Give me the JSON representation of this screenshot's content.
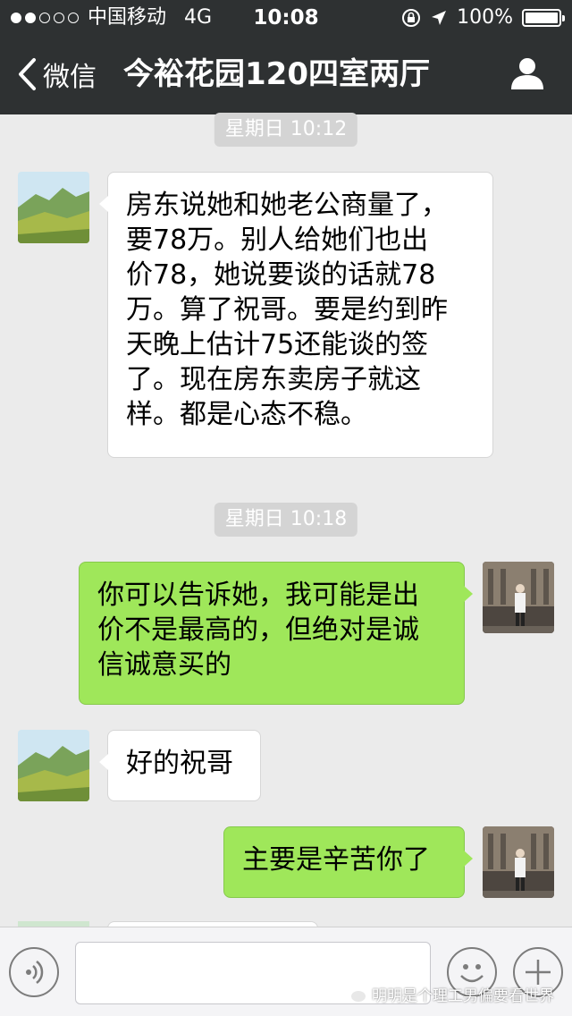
{
  "status_bar": {
    "carrier": "中国移动",
    "network": "4G",
    "time": "10:08",
    "battery": "100%",
    "signal_dots_filled": 2,
    "signal_dots_total": 5
  },
  "nav": {
    "back_label": "微信",
    "title": "今裕花园120四室两厅"
  },
  "messages": [
    {
      "type": "timestamp",
      "text": "星期日 10:12"
    },
    {
      "type": "incoming",
      "lines": [
        "房东说她和她老公商量了，",
        "要78万。别人给她们也出",
        "价78，她说要谈的话就78",
        "万。算了祝哥。要是约到昨",
        "天晚上估计75还能谈的签",
        "了。现在房东卖房子就这",
        "样。都是心态不稳。"
      ]
    },
    {
      "type": "timestamp",
      "text": "星期日 10:18"
    },
    {
      "type": "outgoing",
      "lines": [
        "你可以告诉她，我可能是出",
        "价不是最高的，但绝对是诚",
        "信诚意买的"
      ]
    },
    {
      "type": "incoming",
      "lines": [
        "好的祝哥"
      ]
    },
    {
      "type": "outgoing",
      "lines": [
        "主要是辛苦你了"
      ]
    }
  ],
  "watermark": "明明是个理工男偏要看世界",
  "colors": {
    "nav_bg": "#2e3132",
    "chat_bg": "#ebebeb",
    "outgoing_bubble": "#9fe75a",
    "incoming_bubble": "#ffffff",
    "timestamp_bg": "#d4d4d4"
  },
  "icons": {
    "back": "chevron-left-icon",
    "profile": "person-icon",
    "voice": "voice-icon",
    "emoji": "smiley-icon",
    "more": "plus-icon"
  }
}
